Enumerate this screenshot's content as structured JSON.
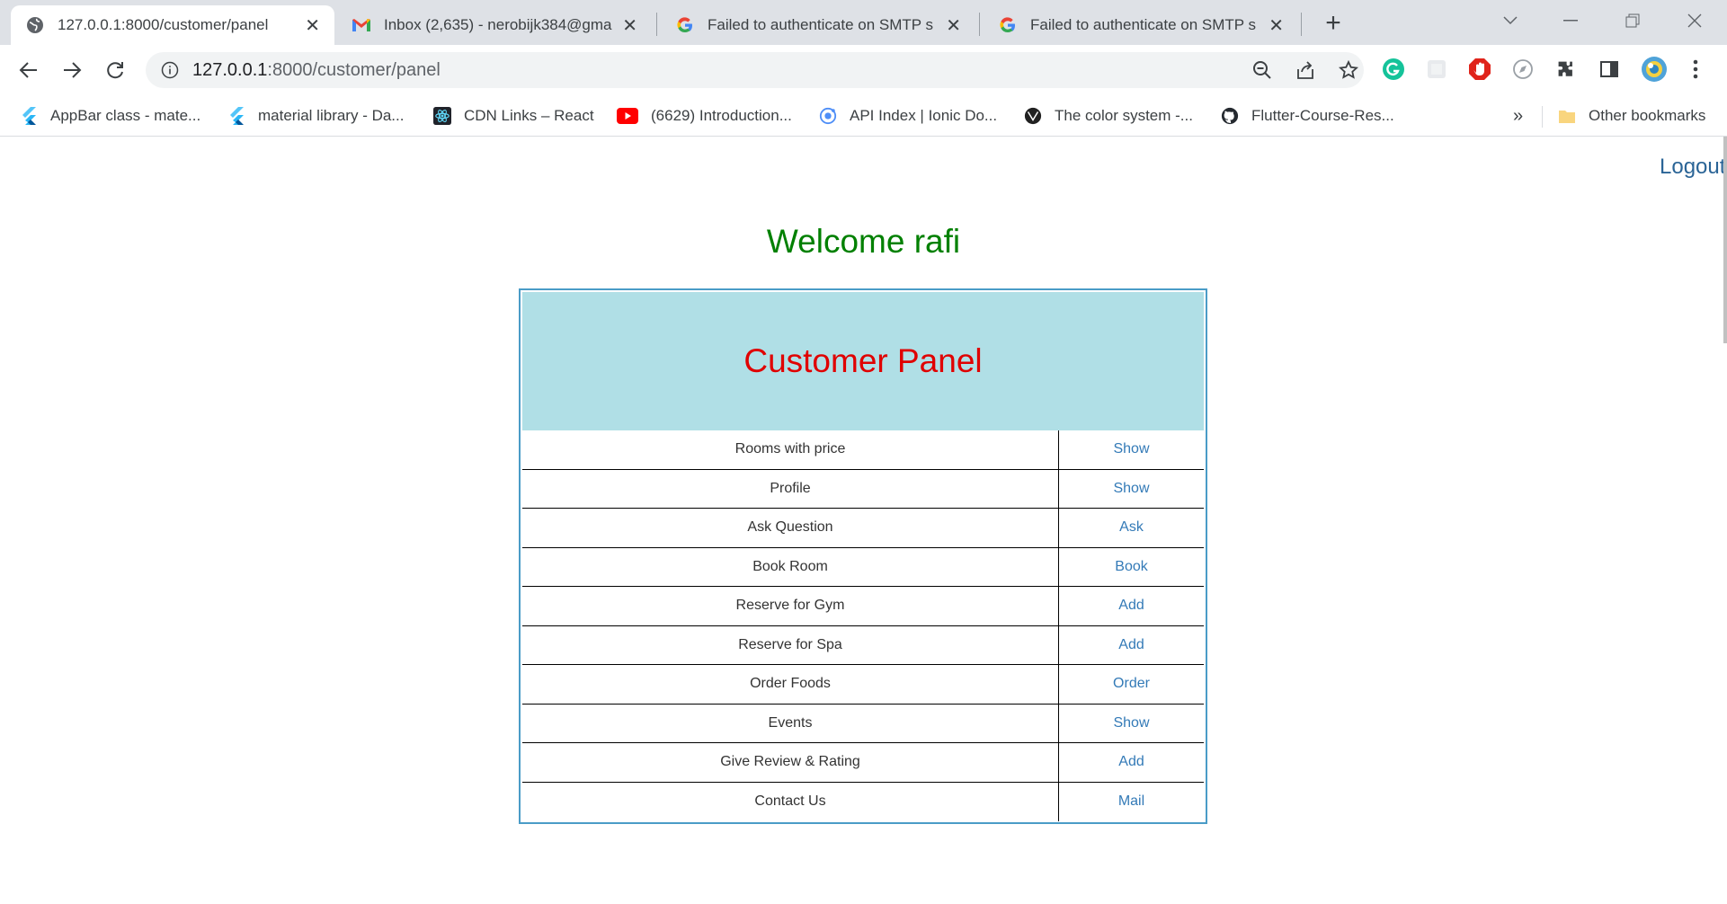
{
  "browser": {
    "tabs": [
      {
        "title": "127.0.0.1:8000/customer/panel",
        "icon": "globe-icon",
        "active": true
      },
      {
        "title": "Inbox (2,635) - nerobijk384@gma",
        "icon": "gmail-icon",
        "active": false
      },
      {
        "title": "Failed to authenticate on SMTP s",
        "icon": "google-icon",
        "active": false
      },
      {
        "title": "Failed to authenticate on SMTP s",
        "icon": "google-icon",
        "active": false
      }
    ],
    "url_host": "127.0.0.1",
    "url_path": ":8000/customer/panel",
    "bookmarks": [
      {
        "label": "AppBar class - mate...",
        "icon": "flutter-icon"
      },
      {
        "label": "material library - Da...",
        "icon": "flutter-icon"
      },
      {
        "label": "CDN Links – React",
        "icon": "react-icon"
      },
      {
        "label": "(6629) Introduction...",
        "icon": "youtube-icon"
      },
      {
        "label": "API Index | Ionic Do...",
        "icon": "ionic-icon"
      },
      {
        "label": "The color system -...",
        "icon": "material-icon"
      },
      {
        "label": "Flutter-Course-Res...",
        "icon": "github-icon"
      }
    ],
    "more_bookmarks": "»",
    "other_bookmarks": "Other bookmarks",
    "colors": {
      "accent_link": "#337ab7",
      "panel_header": "#b0dfe6",
      "panel_title": "#e00000",
      "welcome": "#008000"
    }
  },
  "page": {
    "logout": "Logout",
    "welcome": "Welcome rafi",
    "panel_title": "Customer Panel",
    "rows": [
      {
        "label": "Rooms with price",
        "action": "Show"
      },
      {
        "label": "Profile",
        "action": "Show"
      },
      {
        "label": "Ask Question",
        "action": "Ask"
      },
      {
        "label": "Book Room",
        "action": "Book"
      },
      {
        "label": "Reserve for Gym",
        "action": "Add"
      },
      {
        "label": "Reserve for Spa",
        "action": "Add"
      },
      {
        "label": "Order Foods",
        "action": "Order"
      },
      {
        "label": "Events",
        "action": "Show"
      },
      {
        "label": "Give Review & Rating",
        "action": "Add"
      },
      {
        "label": "Contact Us",
        "action": "Mail"
      }
    ]
  }
}
